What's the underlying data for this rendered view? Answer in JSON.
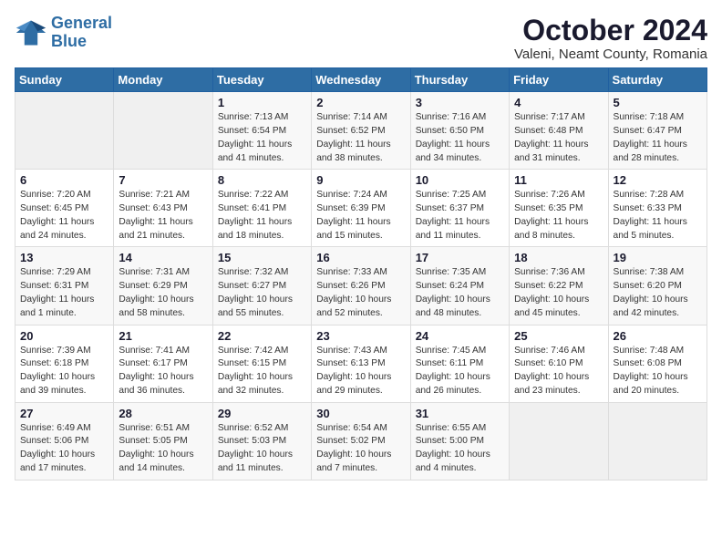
{
  "logo": {
    "line1": "General",
    "line2": "Blue"
  },
  "title": "October 2024",
  "location": "Valeni, Neamt County, Romania",
  "days_header": [
    "Sunday",
    "Monday",
    "Tuesday",
    "Wednesday",
    "Thursday",
    "Friday",
    "Saturday"
  ],
  "weeks": [
    [
      {
        "day": "",
        "info": ""
      },
      {
        "day": "",
        "info": ""
      },
      {
        "day": "1",
        "info": "Sunrise: 7:13 AM\nSunset: 6:54 PM\nDaylight: 11 hours\nand 41 minutes."
      },
      {
        "day": "2",
        "info": "Sunrise: 7:14 AM\nSunset: 6:52 PM\nDaylight: 11 hours\nand 38 minutes."
      },
      {
        "day": "3",
        "info": "Sunrise: 7:16 AM\nSunset: 6:50 PM\nDaylight: 11 hours\nand 34 minutes."
      },
      {
        "day": "4",
        "info": "Sunrise: 7:17 AM\nSunset: 6:48 PM\nDaylight: 11 hours\nand 31 minutes."
      },
      {
        "day": "5",
        "info": "Sunrise: 7:18 AM\nSunset: 6:47 PM\nDaylight: 11 hours\nand 28 minutes."
      }
    ],
    [
      {
        "day": "6",
        "info": "Sunrise: 7:20 AM\nSunset: 6:45 PM\nDaylight: 11 hours\nand 24 minutes."
      },
      {
        "day": "7",
        "info": "Sunrise: 7:21 AM\nSunset: 6:43 PM\nDaylight: 11 hours\nand 21 minutes."
      },
      {
        "day": "8",
        "info": "Sunrise: 7:22 AM\nSunset: 6:41 PM\nDaylight: 11 hours\nand 18 minutes."
      },
      {
        "day": "9",
        "info": "Sunrise: 7:24 AM\nSunset: 6:39 PM\nDaylight: 11 hours\nand 15 minutes."
      },
      {
        "day": "10",
        "info": "Sunrise: 7:25 AM\nSunset: 6:37 PM\nDaylight: 11 hours\nand 11 minutes."
      },
      {
        "day": "11",
        "info": "Sunrise: 7:26 AM\nSunset: 6:35 PM\nDaylight: 11 hours\nand 8 minutes."
      },
      {
        "day": "12",
        "info": "Sunrise: 7:28 AM\nSunset: 6:33 PM\nDaylight: 11 hours\nand 5 minutes."
      }
    ],
    [
      {
        "day": "13",
        "info": "Sunrise: 7:29 AM\nSunset: 6:31 PM\nDaylight: 11 hours\nand 1 minute."
      },
      {
        "day": "14",
        "info": "Sunrise: 7:31 AM\nSunset: 6:29 PM\nDaylight: 10 hours\nand 58 minutes."
      },
      {
        "day": "15",
        "info": "Sunrise: 7:32 AM\nSunset: 6:27 PM\nDaylight: 10 hours\nand 55 minutes."
      },
      {
        "day": "16",
        "info": "Sunrise: 7:33 AM\nSunset: 6:26 PM\nDaylight: 10 hours\nand 52 minutes."
      },
      {
        "day": "17",
        "info": "Sunrise: 7:35 AM\nSunset: 6:24 PM\nDaylight: 10 hours\nand 48 minutes."
      },
      {
        "day": "18",
        "info": "Sunrise: 7:36 AM\nSunset: 6:22 PM\nDaylight: 10 hours\nand 45 minutes."
      },
      {
        "day": "19",
        "info": "Sunrise: 7:38 AM\nSunset: 6:20 PM\nDaylight: 10 hours\nand 42 minutes."
      }
    ],
    [
      {
        "day": "20",
        "info": "Sunrise: 7:39 AM\nSunset: 6:18 PM\nDaylight: 10 hours\nand 39 minutes."
      },
      {
        "day": "21",
        "info": "Sunrise: 7:41 AM\nSunset: 6:17 PM\nDaylight: 10 hours\nand 36 minutes."
      },
      {
        "day": "22",
        "info": "Sunrise: 7:42 AM\nSunset: 6:15 PM\nDaylight: 10 hours\nand 32 minutes."
      },
      {
        "day": "23",
        "info": "Sunrise: 7:43 AM\nSunset: 6:13 PM\nDaylight: 10 hours\nand 29 minutes."
      },
      {
        "day": "24",
        "info": "Sunrise: 7:45 AM\nSunset: 6:11 PM\nDaylight: 10 hours\nand 26 minutes."
      },
      {
        "day": "25",
        "info": "Sunrise: 7:46 AM\nSunset: 6:10 PM\nDaylight: 10 hours\nand 23 minutes."
      },
      {
        "day": "26",
        "info": "Sunrise: 7:48 AM\nSunset: 6:08 PM\nDaylight: 10 hours\nand 20 minutes."
      }
    ],
    [
      {
        "day": "27",
        "info": "Sunrise: 6:49 AM\nSunset: 5:06 PM\nDaylight: 10 hours\nand 17 minutes."
      },
      {
        "day": "28",
        "info": "Sunrise: 6:51 AM\nSunset: 5:05 PM\nDaylight: 10 hours\nand 14 minutes."
      },
      {
        "day": "29",
        "info": "Sunrise: 6:52 AM\nSunset: 5:03 PM\nDaylight: 10 hours\nand 11 minutes."
      },
      {
        "day": "30",
        "info": "Sunrise: 6:54 AM\nSunset: 5:02 PM\nDaylight: 10 hours\nand 7 minutes."
      },
      {
        "day": "31",
        "info": "Sunrise: 6:55 AM\nSunset: 5:00 PM\nDaylight: 10 hours\nand 4 minutes."
      },
      {
        "day": "",
        "info": ""
      },
      {
        "day": "",
        "info": ""
      }
    ]
  ]
}
